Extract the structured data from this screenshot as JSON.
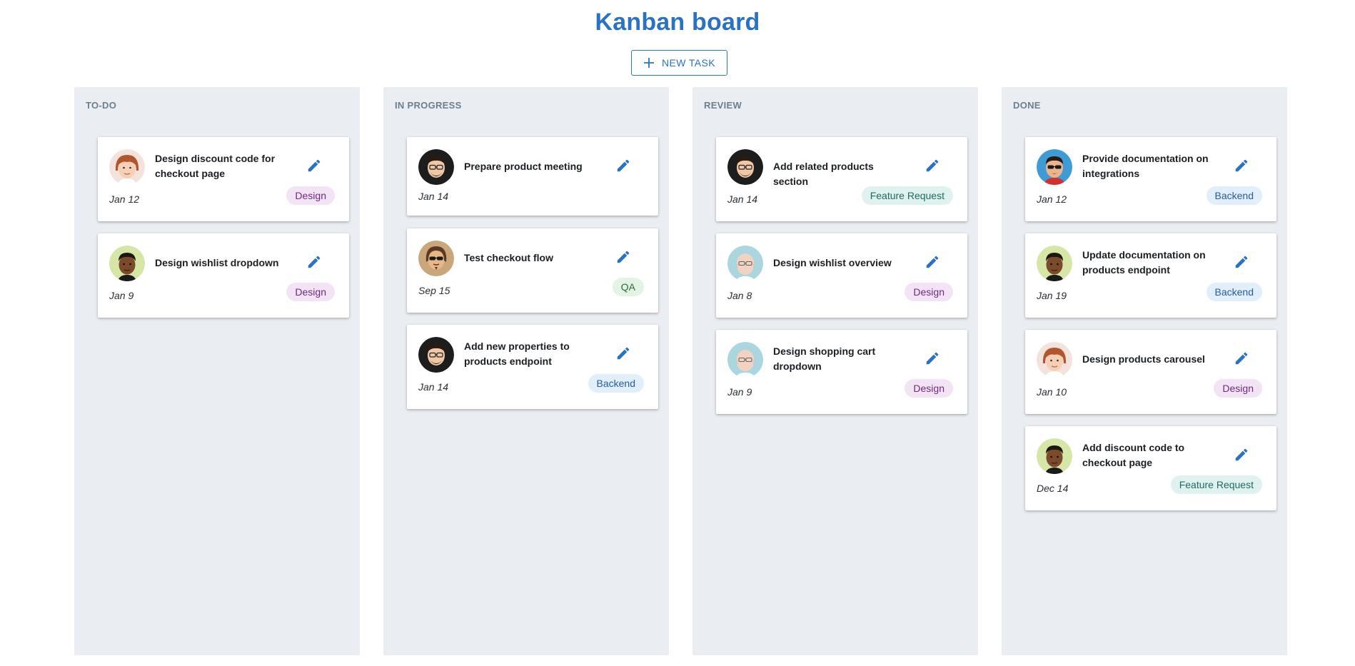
{
  "header": {
    "title": "Kanban board",
    "new_task_label": "NEW TASK",
    "new_task_icon": "plus-icon"
  },
  "colors": {
    "accent": "#2a72c5",
    "column_bg": "#eaedf1",
    "column_title": "#6b7f90"
  },
  "columns": [
    {
      "title": "TO-DO",
      "cards": [
        {
          "title": "Design discount code for checkout page",
          "date": "Jan 12",
          "tag": "Design",
          "avatar": "avatar-redhead"
        },
        {
          "title": "Design wishlist dropdown",
          "date": "Jan 9",
          "tag": "Design",
          "avatar": "avatar-dark-green"
        }
      ]
    },
    {
      "title": "IN PROGRESS",
      "cards": [
        {
          "title": "Prepare product meeting",
          "date": "Jan 14",
          "tag": "",
          "avatar": "avatar-glasses-beard"
        },
        {
          "title": "Test checkout flow",
          "date": "Sep 15",
          "tag": "QA",
          "avatar": "avatar-sunglasses-tan"
        },
        {
          "title": "Add new properties to products endpoint",
          "date": "Jan 14",
          "tag": "Backend",
          "avatar": "avatar-glasses-beard"
        }
      ]
    },
    {
      "title": "REVIEW",
      "cards": [
        {
          "title": "Add related products section",
          "date": "Jan 14",
          "tag": "Feature Request",
          "avatar": "avatar-glasses-beard"
        },
        {
          "title": "Design wishlist overview",
          "date": "Jan 8",
          "tag": "Design",
          "avatar": "avatar-bald-glasses"
        },
        {
          "title": "Design shopping cart dropdown",
          "date": "Jan 9",
          "tag": "Design",
          "avatar": "avatar-bald-glasses"
        }
      ]
    },
    {
      "title": "DONE",
      "cards": [
        {
          "title": "Provide documentation on integrations",
          "date": "Jan 12",
          "tag": "Backend",
          "avatar": "avatar-sunglasses-blue"
        },
        {
          "title": "Update documentation on products endpoint",
          "date": "Jan 19",
          "tag": "Backend",
          "avatar": "avatar-dark-green"
        },
        {
          "title": "Design products carousel",
          "date": "Jan 10",
          "tag": "Design",
          "avatar": "avatar-redhead"
        },
        {
          "title": "Add discount code to checkout page",
          "date": "Dec 14",
          "tag": "Feature Request",
          "avatar": "avatar-dark-green"
        }
      ]
    }
  ]
}
